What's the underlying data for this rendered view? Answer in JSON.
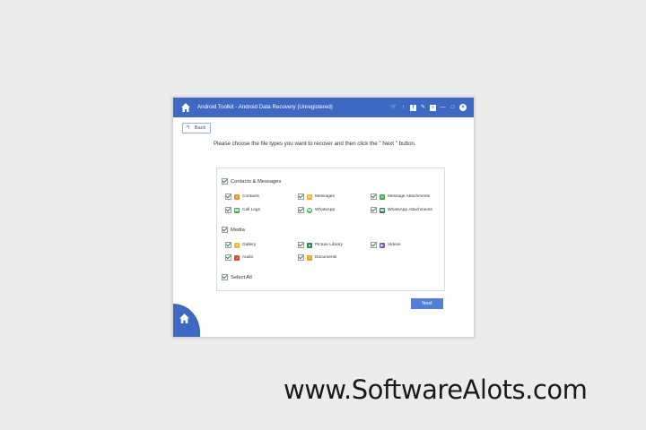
{
  "window": {
    "title": "Android Toolkit - Android Data Recovery (Unregistered)",
    "accent_color": "#3d68c4",
    "toolbar_icons": [
      "cart-icon",
      "key-icon",
      "facebook-icon",
      "feedback-icon",
      "menu-icon"
    ],
    "back_label": "Back"
  },
  "instruction": "Please choose the file types you want to recover and then click the \" Next \" button.",
  "groups": {
    "contacts": {
      "label": "Contacts & Messages",
      "checked": true,
      "items": [
        {
          "label": "Contacts",
          "icon": "contacts-icon",
          "color": "#e8902a"
        },
        {
          "label": "Messages",
          "icon": "messages-icon",
          "color": "#f0b821"
        },
        {
          "label": "Message Attachments",
          "icon": "attachment-icon",
          "color": "#3fa84a"
        },
        {
          "label": "Call Logs",
          "icon": "phone-icon",
          "color": "#3fa84a"
        },
        {
          "label": "WhatsApp",
          "icon": "whatsapp-icon",
          "color": "#2fb34a"
        },
        {
          "label": "WhatsApp Attachments",
          "icon": "whatsapp-attachment-icon",
          "color": "#2a7a5a"
        }
      ]
    },
    "media": {
      "label": "Media",
      "checked": true,
      "items": [
        {
          "label": "Gallery",
          "icon": "gallery-icon",
          "color": "#f0b821"
        },
        {
          "label": "Picture Library",
          "icon": "picture-icon",
          "color": "#2a8a5a"
        },
        {
          "label": "Videos",
          "icon": "video-icon",
          "color": "#7a5cc8"
        },
        {
          "label": "Audio",
          "icon": "audio-icon",
          "color": "#d94a3a"
        },
        {
          "label": "Documents",
          "icon": "document-icon",
          "color": "#f0a020"
        }
      ]
    },
    "select_all": {
      "label": "Select All",
      "checked": true
    }
  },
  "next_label": "Next",
  "watermark": "www.SoftwareAlots.com"
}
